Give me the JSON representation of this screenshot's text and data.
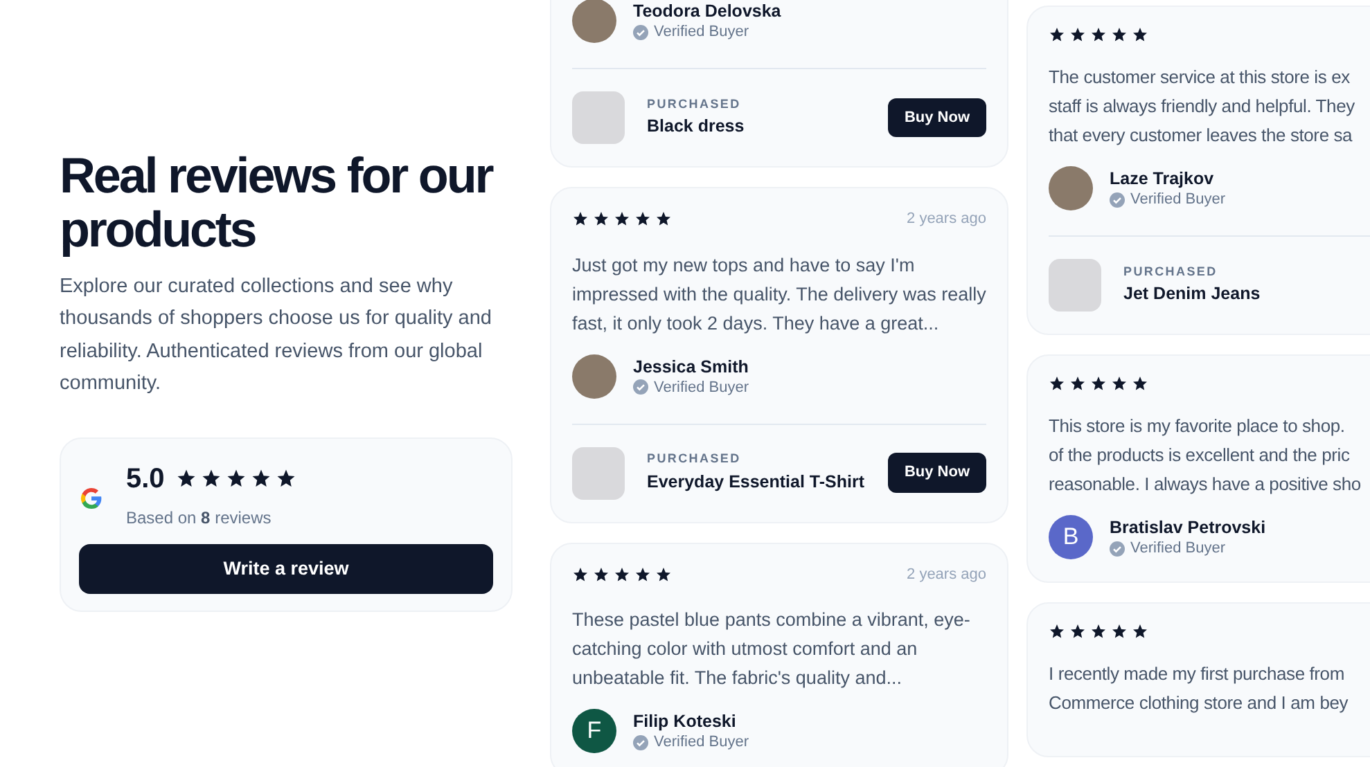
{
  "intro": {
    "heading": "Real reviews for our products",
    "text": "Explore our curated collections and see why thousands of shoppers choose us for quality and reliability. Authenticated reviews from our global community."
  },
  "rating_summary": {
    "score": "5.0",
    "stars": 5,
    "based_on": "Based on **8** reviews",
    "button": "Write a review"
  },
  "columns": [
    {
      "reviews": [
        {
          "author": {
            "name": "Teodora Delovska",
            "badge": "Verified Buyer",
            "avatar": {
              "kind": "photo"
            }
          },
          "product": {
            "label": "PURCHASED",
            "name": "Black dress",
            "button": "Buy Now"
          }
        },
        {
          "stars": 5,
          "time": "2 years ago",
          "text": "Just got my new tops and have to say I'm impressed with the quality. The delivery was really fast, it only took 2 days. They have a great...",
          "author": {
            "name": "Jessica Smith",
            "badge": "Verified Buyer",
            "avatar": {
              "kind": "photo"
            }
          },
          "product": {
            "label": "PURCHASED",
            "name": "Everyday Essential T-Shirt",
            "button": "Buy Now"
          }
        },
        {
          "stars": 5,
          "time": "2 years ago",
          "text": "These pastel blue pants combine a vibrant, eye-catching color with utmost comfort and an unbeatable fit. The fabric's quality and...",
          "author": {
            "name": "Filip Koteski",
            "badge": "Verified Buyer",
            "avatar": {
              "kind": "initial",
              "letter": "F",
              "color": "#0f5744"
            }
          }
        }
      ]
    },
    {
      "reviews": [
        {
          "stars": 5,
          "text": "The customer service at this store is ex\nstaff is always friendly and helpful. They\nthat every customer leaves the store sa",
          "author": {
            "name": "Laze Trajkov",
            "badge": "Verified Buyer",
            "avatar": {
              "kind": "photo"
            }
          },
          "product": {
            "label": "PURCHASED",
            "name": "Jet Denim Jeans"
          }
        },
        {
          "stars": 5,
          "text": "This store is my favorite place to shop.\nof the products is excellent and the pric\nreasonable. I always have a positive sho",
          "author": {
            "name": "Bratislav Petrovski",
            "badge": "Verified Buyer",
            "avatar": {
              "kind": "initial",
              "letter": "B",
              "color": "#5a68c9"
            }
          }
        },
        {
          "stars": 5,
          "text": "I recently made my first purchase from\nCommerce clothing store and I am bey"
        }
      ]
    }
  ]
}
